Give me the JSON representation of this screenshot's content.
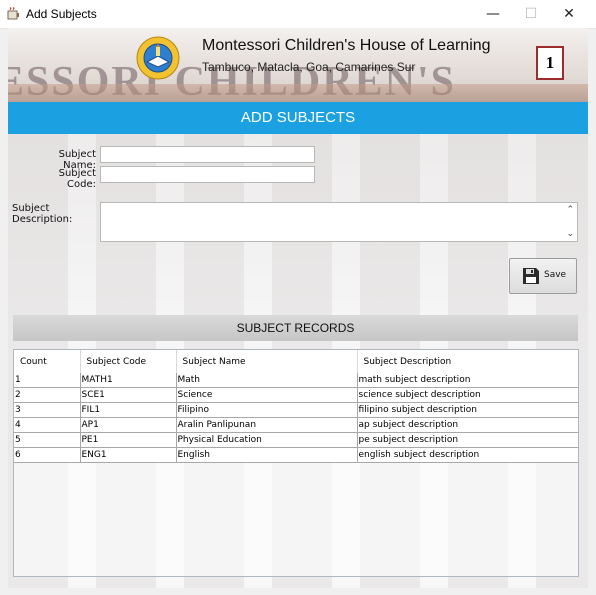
{
  "window": {
    "title": "Add Subjects",
    "minimize_icon": "minimize-icon",
    "maximize_icon": "maximize-icon",
    "close_icon": "close-icon"
  },
  "banner": {
    "school_name": "Montessori Children's House of Learning",
    "address": "Tambuco, Matacla, Goa, Camarines Sur",
    "background_text": "ESSORI CHILDREN'S",
    "page_number": "1"
  },
  "header": {
    "title": "ADD SUBJECTS"
  },
  "form": {
    "subject_name_label": "Subject Name:",
    "subject_name_value": "",
    "subject_code_label": "Subject Code:",
    "subject_code_value": "",
    "subject_description_label": "Subject Description:",
    "subject_description_value": ""
  },
  "save_button": {
    "label": "Save",
    "icon": "floppy-disk-icon"
  },
  "records": {
    "title": "SUBJECT RECORDS",
    "columns": [
      "Count",
      "Subject Code",
      "Subject Name",
      "Subject Description"
    ],
    "rows": [
      [
        "1",
        "MATH1",
        "Math",
        "math subject description"
      ],
      [
        "2",
        "SCE1",
        "Science",
        "science subject description"
      ],
      [
        "3",
        "FIL1",
        "Filipino",
        "filipino subject description"
      ],
      [
        "4",
        "AP1",
        "Aralin Panlipunan",
        "ap subject description"
      ],
      [
        "5",
        "PE1",
        "Physical Education",
        "pe subject description"
      ],
      [
        "6",
        "ENG1",
        "English",
        "english subject description"
      ]
    ]
  },
  "colors": {
    "accent": "#1ba1e2",
    "records_bar": "#c9c9c9",
    "badge_border": "#9b2d2d"
  }
}
